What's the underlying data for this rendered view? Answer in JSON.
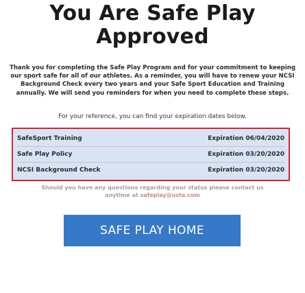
{
  "header": {
    "title_line1": "You Are Safe Play",
    "title_line2": "Approved"
  },
  "intro": {
    "text": "Thank you for completing the Safe Play Program and for your commitment to keeping our sport safe for all of our athletes. As a reminder, you will have to renew your NCSI Background Check every two years and your Safe Sport Education and Training annually. We will send you reminders for when you need to complete these steps."
  },
  "reference_text": "For your reference, you can find your expiration dates below.",
  "expirations": [
    {
      "label": "SafeSport Training",
      "expiration": "Expiration 06/04/2020"
    },
    {
      "label": "Safe Play Policy",
      "expiration": "Expiration 03/20/2020"
    },
    {
      "label": "NCSI Background Check",
      "expiration": "Expiration 03/20/2020"
    }
  ],
  "contact": {
    "line1": "Should you have any questions regarding your status please contact us",
    "line2_prefix": "anytime at ",
    "email": "safeplay@usta.com"
  },
  "cta": {
    "label": "SAFE PLAY HOME"
  },
  "colors": {
    "highlight_border": "#d9262c",
    "table_bg": "#d9e3f4",
    "button_bg": "#3679c8"
  }
}
